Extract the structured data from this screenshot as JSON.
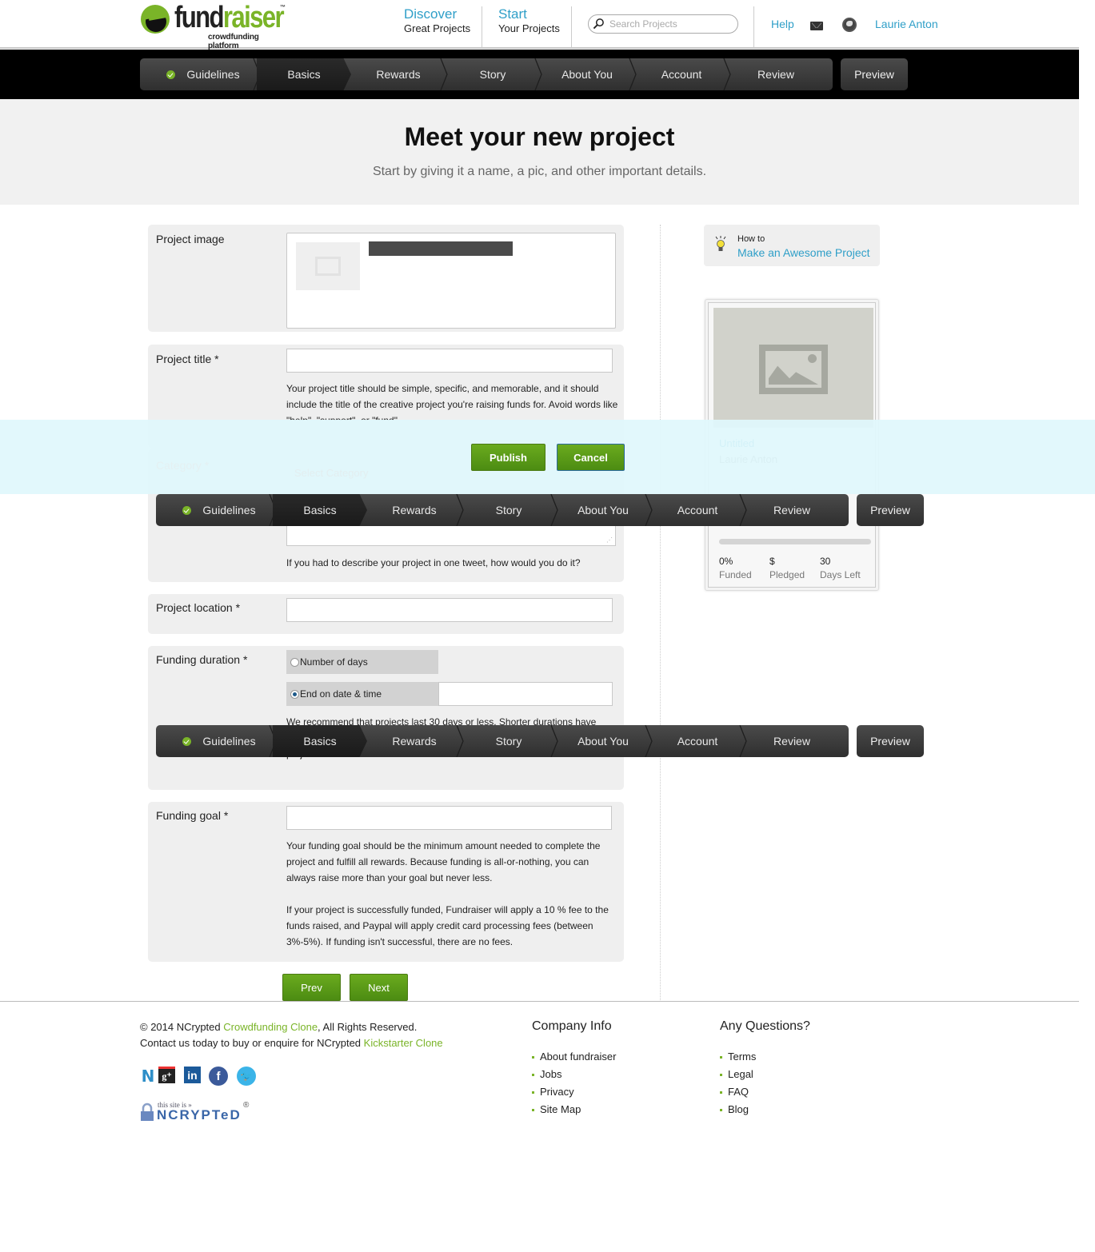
{
  "header": {
    "logo_main": "fund",
    "logo_accent": "raiser",
    "logo_tm": "™",
    "logo_sub": "crowdfunding platform",
    "nav": [
      {
        "title": "Discover",
        "subtitle": "Great Projects"
      },
      {
        "title": "Start",
        "subtitle": "Your Projects"
      }
    ],
    "search_placeholder": "Search Projects",
    "help_label": "Help",
    "user_name": "Laurie Anton"
  },
  "steps": {
    "items": [
      "Guidelines",
      "Basics",
      "Rewards",
      "Story",
      "About You",
      "Account",
      "Review"
    ],
    "completed": [
      "Guidelines"
    ],
    "active": "Basics",
    "preview_label": "Preview"
  },
  "hero": {
    "title": "Meet your new project",
    "subtitle": "Start by giving it a name, a pic, and other important details."
  },
  "form": {
    "project_image_label": "Project image",
    "project_title_label": "Project title *",
    "project_title_value": "",
    "project_title_help": "Your project title should be simple, specific, and memorable, and it should include the title of the creative project you're raising funds for. Avoid words like \"help\", \"support\", or \"fund\".",
    "category_label": "Category *",
    "category_selected": "Select Category",
    "short_blurb_help": "If you had to describe your project in one tweet, how would you do it?",
    "location_label": "Project location *",
    "location_value": "",
    "duration_label": "Funding duration *",
    "duration_options": [
      {
        "label": "Number of days",
        "selected": false
      },
      {
        "label": "End on date & time",
        "selected": true
      }
    ],
    "duration_date_value": "",
    "duration_help": "We recommend that projects last 30 days or less. Shorter durations have higher success rates, and will create a helpful sense of urgency around your project.",
    "goal_label": "Funding goal *",
    "goal_value": "",
    "goal_help_1": "Your funding goal should be the minimum amount needed to complete the project and fulfill all rewards. Because funding is all-or-nothing, you can always raise more than your goal but never less.",
    "goal_help_2": "If your project is successfully funded, Fundraiser will apply a 10 % fee to the funds raised, and Paypal will apply credit card processing fees (between 3%-5%). If funding isn't successful, there are no fees.",
    "prev_label": "Prev",
    "next_label": "Next"
  },
  "overlay": {
    "publish_label": "Publish",
    "cancel_label": "Cancel"
  },
  "sidebar": {
    "howto_small": "How to",
    "howto_link": "Make an Awesome Project",
    "card": {
      "title": "Untitled",
      "author": "Laurie Anton",
      "funded_fraction": 0,
      "stats": [
        {
          "value": "0%",
          "label": "Funded"
        },
        {
          "value": "$",
          "label": "Pledged"
        },
        {
          "value": "30",
          "label": "Days Left"
        }
      ]
    }
  },
  "footer": {
    "copyright_pre": "© 2014 NCrypted ",
    "copyright_link": "Crowdfunding Clone",
    "copyright_post": ", All Rights Reserved.",
    "contact_pre": "Contact us today to buy or enquire for NCrypted ",
    "contact_link": "Kickstarter Clone",
    "social": [
      "ncrypted-icon",
      "google-plus-icon",
      "linkedin-icon",
      "facebook-icon",
      "twitter-icon"
    ],
    "badge_small": "this site is »",
    "badge_main": "NCRYPTeD",
    "badge_reg": "®",
    "company_heading": "Company Info",
    "company_links": [
      "About fundraiser",
      "Jobs",
      "Privacy",
      "Site Map"
    ],
    "questions_heading": "Any Questions?",
    "questions_links": [
      "Terms",
      "Legal",
      "FAQ",
      "Blog"
    ]
  },
  "colors": {
    "brand_green": "#7ab428",
    "link_blue": "#2f9fc8",
    "overlay_bg": "#e0f8fc"
  }
}
